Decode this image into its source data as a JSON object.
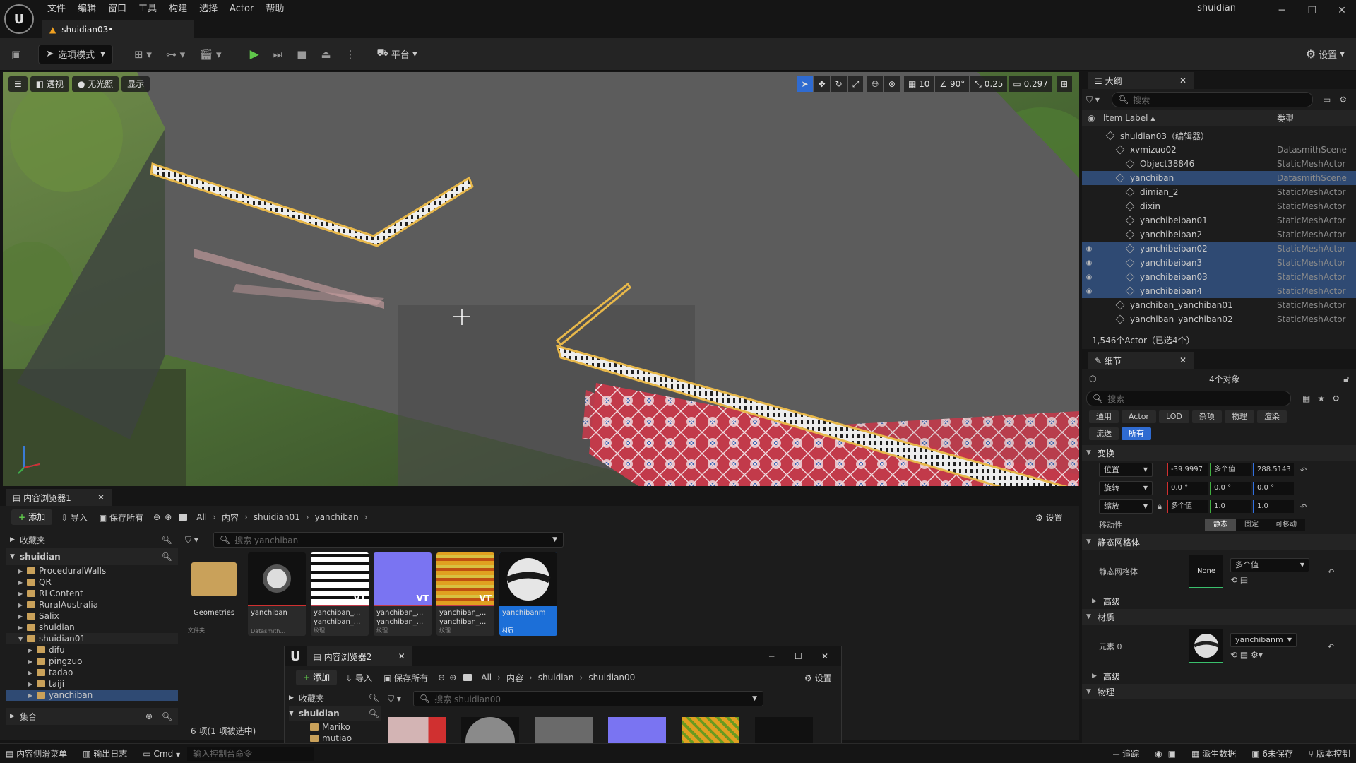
{
  "titlebar": {
    "menu": [
      "文件",
      "编辑",
      "窗口",
      "工具",
      "构建",
      "选择",
      "Actor",
      "帮助"
    ],
    "doc_tab": "shuidian03•",
    "project": "shuidian",
    "logo_icon": "unreal-logo-icon"
  },
  "toolbar": {
    "mode": "选项模式",
    "platform": "平台",
    "settings": "设置"
  },
  "viewport": {
    "buttons": [
      "透视",
      "无光照",
      "显示"
    ],
    "grid_snap": "10",
    "rot_snap": "90°",
    "scale_snap": "0.25",
    "camera_speed": "0.297"
  },
  "outliner": {
    "tab": "大纲",
    "search_placeholder": "搜索",
    "col_label": "Item Label ▴",
    "col_type": "类型",
    "rows": [
      {
        "name": "shuidian03（编辑器）",
        "type": "",
        "indent": 1,
        "sel": false,
        "eye": false
      },
      {
        "name": "xvmizuo02",
        "type": "DatasmithScene",
        "indent": 2,
        "sel": false,
        "eye": false
      },
      {
        "name": "Object38846",
        "type": "StaticMeshActor",
        "indent": 3,
        "sel": false,
        "eye": false
      },
      {
        "name": "yanchiban",
        "type": "DatasmithScene",
        "indent": 2,
        "sel": true,
        "eye": false
      },
      {
        "name": "dimian_2",
        "type": "StaticMeshActor",
        "indent": 3,
        "sel": false,
        "eye": false
      },
      {
        "name": "dixin",
        "type": "StaticMeshActor",
        "indent": 3,
        "sel": false,
        "eye": false
      },
      {
        "name": "yanchibeiban01",
        "type": "StaticMeshActor",
        "indent": 3,
        "sel": false,
        "eye": false
      },
      {
        "name": "yanchibeiban2",
        "type": "StaticMeshActor",
        "indent": 3,
        "sel": false,
        "eye": false
      },
      {
        "name": "yanchibeiban02",
        "type": "StaticMeshActor",
        "indent": 3,
        "sel": true,
        "eye": true
      },
      {
        "name": "yanchibeiban3",
        "type": "StaticMeshActor",
        "indent": 3,
        "sel": true,
        "eye": true
      },
      {
        "name": "yanchibeiban03",
        "type": "StaticMeshActor",
        "indent": 3,
        "sel": true,
        "eye": true
      },
      {
        "name": "yanchibeiban4",
        "type": "StaticMeshActor",
        "indent": 3,
        "sel": true,
        "eye": true
      },
      {
        "name": "yanchiban_yanchiban01",
        "type": "StaticMeshActor",
        "indent": 2,
        "sel": false,
        "eye": false
      },
      {
        "name": "yanchiban_yanchiban02",
        "type": "StaticMeshActor",
        "indent": 2,
        "sel": false,
        "eye": false
      }
    ],
    "footer": "1,546个Actor（已选4个）"
  },
  "details": {
    "tab": "细节",
    "objects": "4个对象",
    "search_placeholder": "搜索",
    "cat_tabs": [
      "通用",
      "Actor",
      "LOD",
      "杂项",
      "物理",
      "渲染"
    ],
    "cat_tabs2": [
      "流送",
      "所有"
    ],
    "sec_transform": "变换",
    "position": {
      "label": "位置",
      "x": "-39.9997",
      "y": "多个值",
      "z": "288.5143"
    },
    "rotation": {
      "label": "旋转",
      "x": "0.0 °",
      "y": "0.0 °",
      "z": "0.0 °"
    },
    "scale": {
      "label": "缩放",
      "x": "多个值",
      "y": "1.0",
      "z": "1.0"
    },
    "mobility": {
      "label": "移动性",
      "options": [
        "静态",
        "固定",
        "可移动"
      ]
    },
    "sec_static_mesh": "静态网格体",
    "static_mesh_label": "静态网格体",
    "static_mesh_thumb": "None",
    "static_mesh_value": "多个值",
    "advanced": "高级",
    "sec_materials": "材质",
    "element0_label": "元素 0",
    "element0_value": "yanchibanm",
    "advanced2": "高级",
    "sec_physics": "物理"
  },
  "cb1": {
    "tab": "内容浏览器1",
    "add": "添加",
    "import": "导入",
    "save_all": "保存所有",
    "crumbs": [
      "All",
      "内容",
      "shuidian01",
      "yanchiban"
    ],
    "settings": "设置",
    "favorites": "收藏夹",
    "root": "shuidian",
    "tree": [
      "ProceduralWalls",
      "QR",
      "RLContent",
      "RuralAustralia",
      "Salix",
      "shuidian",
      "shuidian01",
      "difu",
      "pingzuo",
      "tadao",
      "taiji",
      "yanchiban"
    ],
    "collections": "集合",
    "search_placeholder": "搜索 yanchiban",
    "assets": [
      {
        "label": "Geometries",
        "label2": "",
        "sub": "文件夹"
      },
      {
        "label": "yanchiban",
        "label2": "",
        "sub": "Datasmith..."
      },
      {
        "label": "yanchiban_...",
        "label2": "yanchiban_...",
        "sub": "纹理"
      },
      {
        "label": "yanchiban_...",
        "label2": "yanchiban_...",
        "sub": "纹理"
      },
      {
        "label": "yanchiban_...",
        "label2": "yanchiban_...",
        "sub": "纹理"
      },
      {
        "label": "yanchibanm",
        "label2": "",
        "sub": "材质"
      }
    ],
    "count": "6 项(1 项被选中)"
  },
  "cb2": {
    "tab": "内容浏览器2",
    "add": "添加",
    "import": "导入",
    "save_all": "保存所有",
    "crumbs": [
      "All",
      "内容",
      "shuidian",
      "shuidian00"
    ],
    "settings": "设置",
    "favorites": "收藏夹",
    "root": "shuidian",
    "tree": [
      "Mariko",
      "mutiao"
    ],
    "search_placeholder": "搜索 shuidian00"
  },
  "statusbar": {
    "left": [
      "内容侧滑菜单",
      "输出日志",
      "Cmd"
    ],
    "console_placeholder": "输入控制台命令",
    "right": [
      "追踪",
      "派生数据",
      "6未保存",
      "版本控制"
    ]
  },
  "colors": {
    "accent": "#2f6bd1",
    "selection": "#2f4a73",
    "play": "#5fc64a",
    "highlight": "#e8b84a"
  }
}
